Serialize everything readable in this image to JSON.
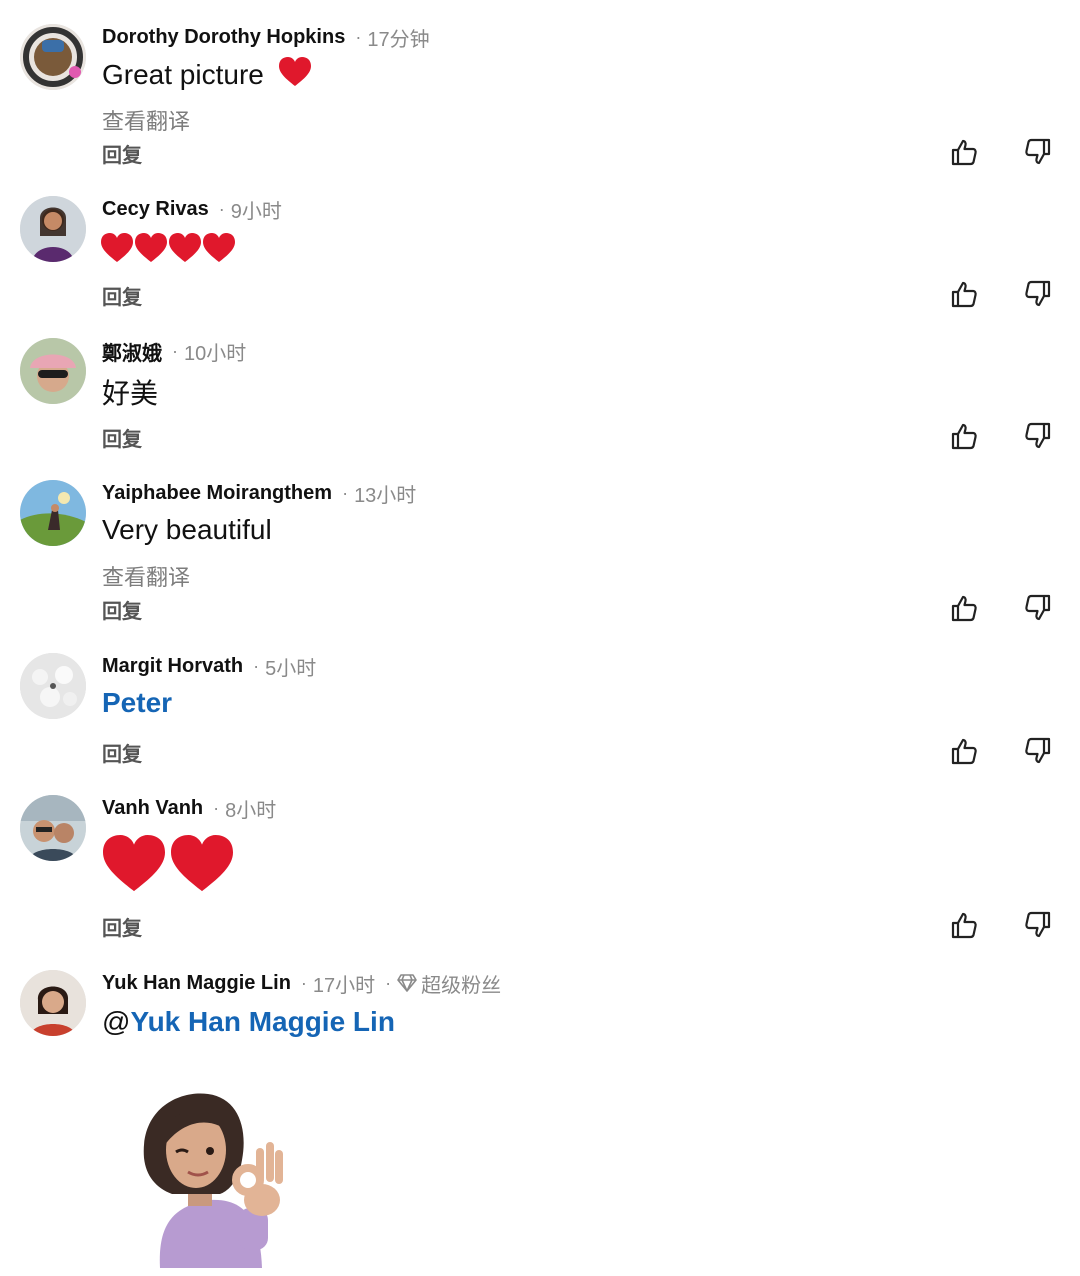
{
  "labels": {
    "translate": "查看翻译",
    "reply": "回复"
  },
  "comments": [
    {
      "name": "Dorothy Dorothy Hopkins",
      "time": "17分钟",
      "text": "Great picture",
      "emoji": "heart",
      "translate": "查看翻译",
      "reply": "回复"
    },
    {
      "name": "Cecy Rivas",
      "time": "9小时",
      "emoji_text": "❤️❤️❤️❤️",
      "emoji_count": 4,
      "reply": "回复"
    },
    {
      "name": "鄭淑娥",
      "time": "10小时",
      "text": "好美",
      "reply": "回复"
    },
    {
      "name": "Yaiphabee Moirangthem",
      "time": "13小时",
      "text": "Very beautiful",
      "translate": "查看翻译",
      "reply": "回复"
    },
    {
      "name": "Margit Horvath",
      "time": "5小时",
      "text": "Peter",
      "reply": "回复"
    },
    {
      "name": "Vanh Vanh",
      "time": "8小时",
      "emoji_text": "❤️❤️",
      "emoji_count": 2,
      "reply": "回复"
    },
    {
      "name": "Yuk Han Maggie Lin",
      "time": "17小时",
      "badge": "超级粉丝",
      "at": "@",
      "mention": "Yuk Han Maggie Lin"
    }
  ],
  "icons": {
    "like": "thumbs-up-icon",
    "dislike": "thumbs-down-icon",
    "badge": "diamond-icon",
    "emoji": "red-heart"
  },
  "colors": {
    "link": "#1565b5",
    "meta": "#8a8a8a",
    "heart": "#e0182c"
  }
}
